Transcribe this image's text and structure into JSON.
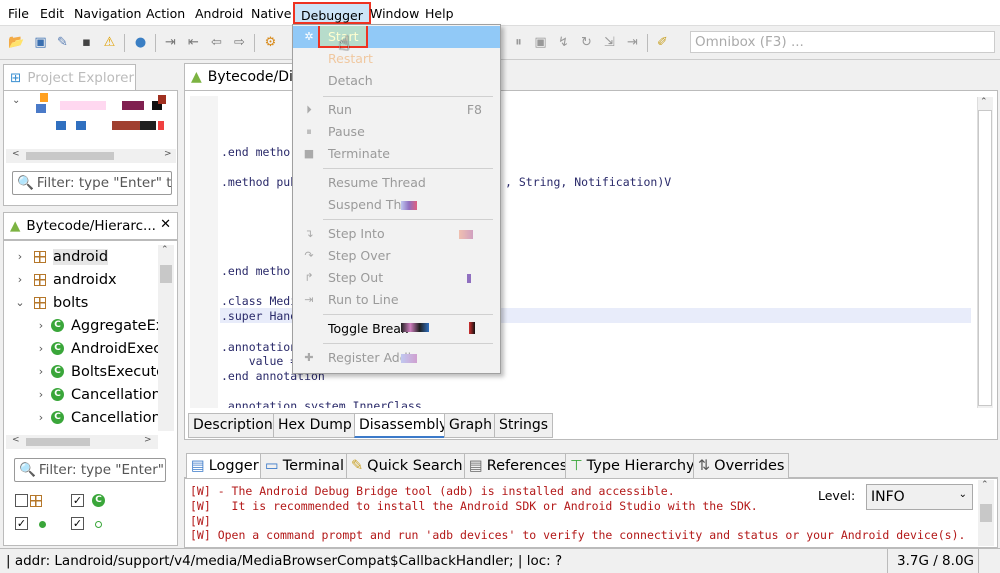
{
  "menubar": {
    "items": [
      "File",
      "Edit",
      "Navigation",
      "Action",
      "Android",
      "Native",
      "Debugger",
      "Window",
      "Help"
    ]
  },
  "toolbar": {
    "omnibox_placeholder": "Omnibox (F3) ..."
  },
  "project_pane": {
    "title": "Project Explorer"
  },
  "filter_top": {
    "placeholder": "Filter: type \"Enter\" t"
  },
  "hierarchy": {
    "title": "Bytecode/Hierarc...",
    "rows": [
      {
        "label": "android",
        "kind": "package",
        "expanded": false
      },
      {
        "label": "androidx",
        "kind": "package",
        "expanded": false
      },
      {
        "label": "bolts",
        "kind": "package",
        "expanded": true
      },
      {
        "label": "AggregateEx",
        "kind": "class"
      },
      {
        "label": "AndroidExec",
        "kind": "class"
      },
      {
        "label": "BoltsExecuto",
        "kind": "class"
      },
      {
        "label": "Cancellation",
        "kind": "class"
      },
      {
        "label": "Cancellation",
        "kind": "class"
      }
    ],
    "filter_placeholder": "Filter: type \"Enter\""
  },
  "editor": {
    "tab_title": "Bytecode/Dis",
    "code": {
      "l1": ".end metho",
      "l2a": ".method pub",
      "l2b": ", String, Notification)V",
      "l3": ".end metho",
      "l4": ".class Medi",
      "l5": ".super Hand",
      "l6": ".annotation",
      "l7": "    value =",
      "l8": ".end annotation",
      "l9": ".annotation system InnerClass"
    },
    "bottom_tabs": [
      "Description",
      "Hex Dump",
      "Disassembly",
      "Graph",
      "Strings"
    ],
    "selected_tab": "Disassembly"
  },
  "logger": {
    "tabs": [
      "Logger",
      "Terminal",
      "Quick Search",
      "References",
      "Type Hierarchy",
      "Overrides"
    ],
    "lines": [
      "[W] - The Android Debug Bridge tool (adb) is installed and accessible.",
      "[W]   It is recommended to install the Android SDK or Android Studio with the SDK.",
      "[W]",
      "[W] Open a command prompt and run 'adb devices' to verify the connectivity and status or your Android device(s)."
    ],
    "level_label": "Level:",
    "level_value": "INFO"
  },
  "status": {
    "text": "| addr: Landroid/support/v4/media/MediaBrowserCompat$CallbackHandler; | loc: ?",
    "memory": "3.7G / 8.0G"
  },
  "debugger_menu": {
    "items": [
      {
        "label": "Start",
        "shortcut": "",
        "state": "highlighted",
        "icon": "bug-icon"
      },
      {
        "label": "Restart",
        "shortcut": "",
        "state": "disabled",
        "icon": ""
      },
      {
        "label": "Detach",
        "shortcut": "",
        "state": "disabled",
        "icon": ""
      },
      {
        "label": "Run",
        "shortcut": "F8",
        "state": "disabled",
        "icon": "run-icon"
      },
      {
        "label": "Pause",
        "shortcut": "",
        "state": "disabled",
        "icon": "pause-icon"
      },
      {
        "label": "Terminate",
        "shortcut": "",
        "state": "disabled",
        "icon": "stop-icon"
      },
      {
        "label": "Resume Thread",
        "shortcut": "",
        "state": "disabled",
        "icon": ""
      },
      {
        "label": "Suspend Thre",
        "shortcut": "",
        "state": "disabled",
        "icon": ""
      },
      {
        "label": "Step Into",
        "shortcut": "",
        "state": "disabled",
        "icon": "step-into-icon"
      },
      {
        "label": "Step Over",
        "shortcut": "",
        "state": "disabled",
        "icon": "step-over-icon"
      },
      {
        "label": "Step Out",
        "shortcut": "",
        "state": "disabled",
        "icon": "step-out-icon"
      },
      {
        "label": "Run to Line",
        "shortcut": "",
        "state": "disabled",
        "icon": "run-to-line-icon"
      },
      {
        "label": "Toggle Break",
        "shortcut": "",
        "state": "enabled",
        "icon": ""
      },
      {
        "label": "Register Addi",
        "shortcut": "",
        "state": "disabled",
        "icon": "plus-icon"
      }
    ]
  }
}
